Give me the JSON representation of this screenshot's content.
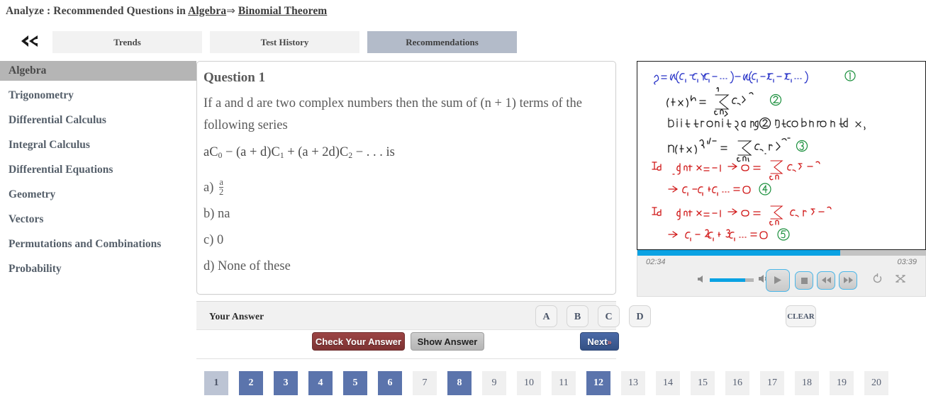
{
  "header": {
    "prefix": "Analyze : Recommended Questions in ",
    "subject_link": "Algebra",
    "arrow": "⇒",
    "topic_link": "Binomial Theorem"
  },
  "nav": {
    "back_icon": "«",
    "tabs": [
      {
        "label": "Trends",
        "active": false
      },
      {
        "label": "Test History",
        "active": false
      },
      {
        "label": "Recommendations",
        "active": true
      }
    ]
  },
  "sidebar": {
    "items": [
      {
        "label": "Algebra",
        "active": true
      },
      {
        "label": "Trigonometry",
        "active": false
      },
      {
        "label": "Differential Calculus",
        "active": false
      },
      {
        "label": "Integral Calculus",
        "active": false
      },
      {
        "label": "Differential Equations",
        "active": false
      },
      {
        "label": "Geometry",
        "active": false
      },
      {
        "label": "Vectors",
        "active": false
      },
      {
        "label": "Permutations and Combinations",
        "active": false
      },
      {
        "label": "Probability",
        "active": false
      }
    ]
  },
  "question": {
    "title": "Question 1",
    "stem": "If a and d are two complex numbers then the sum of (n + 1) terms of the following series",
    "formula_text": "aC0 − (a + d)C1 + (a + 2d)C2 − . . .  is",
    "formula_parts": {
      "p1": "aC",
      "s1": "0",
      "p2": " − (a + d)C",
      "s2": "1",
      "p3": " + (a + 2d)C",
      "s3": "2",
      "p4": " − . . .  is"
    },
    "options": [
      {
        "key": "a)",
        "text": "",
        "fraction": {
          "numerator": "a",
          "denominator": "2"
        }
      },
      {
        "key": "b)",
        "text": "na",
        "fraction": null
      },
      {
        "key": "c)",
        "text": "0",
        "fraction": null
      },
      {
        "key": "d)",
        "text": "None of these",
        "fraction": null
      }
    ]
  },
  "answer_bar": {
    "label": "Your Answer",
    "choices": [
      "A",
      "B",
      "C",
      "D"
    ],
    "clear_label": "CLEAR"
  },
  "actions": {
    "check_label": "Check Your Answer",
    "show_label": "Show Answer",
    "next_label": "Next",
    "next_chevron": "»"
  },
  "pagination": {
    "pages": [
      {
        "num": "1",
        "state": "current"
      },
      {
        "num": "2",
        "state": "visited"
      },
      {
        "num": "3",
        "state": "visited"
      },
      {
        "num": "4",
        "state": "visited"
      },
      {
        "num": "5",
        "state": "visited"
      },
      {
        "num": "6",
        "state": "visited"
      },
      {
        "num": "7",
        "state": "default"
      },
      {
        "num": "8",
        "state": "visited"
      },
      {
        "num": "9",
        "state": "default"
      },
      {
        "num": "10",
        "state": "default"
      },
      {
        "num": "11",
        "state": "default"
      },
      {
        "num": "12",
        "state": "visited"
      },
      {
        "num": "13",
        "state": "default"
      },
      {
        "num": "14",
        "state": "default"
      },
      {
        "num": "15",
        "state": "default"
      },
      {
        "num": "16",
        "state": "default"
      },
      {
        "num": "17",
        "state": "default"
      },
      {
        "num": "18",
        "state": "default"
      },
      {
        "num": "19",
        "state": "default"
      },
      {
        "num": "20",
        "state": "default"
      }
    ]
  },
  "whiteboard": {
    "lines": [
      {
        "text": "S = a(C₀ − C₁ + C₂ −...) − d(C₁ − 2C₂ + 3C₃ −...)",
        "color": "#2a35c8",
        "tag": "①",
        "tag_color": "#1a8f3c"
      },
      {
        "text": "(1+ x)ⁿ =  Σ  Cᵣ xʳ",
        "color": "#1a1a1a",
        "tag": "②",
        "tag_color": "#1a8f3c"
      },
      {
        "text": "Differentiating ② with respect to x,",
        "color": "#1a1a1a",
        "tag": "",
        "tag_color": ""
      },
      {
        "text": "n(1+x)ⁿ⁻¹ =  Σ  Cᵣ . r xʳ⁻¹",
        "color": "#1a1a1a",
        "tag": "③",
        "tag_color": "#1a8f3c"
      },
      {
        "text": "In ②, put x = −1  ⇒  0 = Σ Cᵣ (−)ʳ",
        "color": "#d01818",
        "tag": "",
        "tag_color": ""
      },
      {
        "text": "⇒  C₀ − C₁ + C₂ −... = 0",
        "color": "#d01818",
        "tag": "④",
        "tag_color": "#1a8f3c"
      },
      {
        "text": "In ③, put x = −1 ⇒ 0 = Σ Cᵣ· r (−)ʳ⁻¹",
        "color": "#d01818",
        "tag": "",
        "tag_color": ""
      },
      {
        "text": "⇒  C₁ − 2C₂ + 3C₃ −... = 0",
        "color": "#d01818",
        "tag": "⑤",
        "tag_color": "#1a8f3c"
      }
    ]
  },
  "player": {
    "current_time": "02:34",
    "total_time": "03:39",
    "progress_percent": 70,
    "volume_percent": 80,
    "controls": [
      {
        "name": "volume-down-icon",
        "glyph": "◀"
      },
      {
        "name": "volume-up-icon",
        "glyph": "🔊"
      },
      {
        "name": "play-button",
        "glyph": "▶"
      },
      {
        "name": "stop-button",
        "glyph": "■"
      },
      {
        "name": "rewind-button",
        "glyph": "◀◀"
      },
      {
        "name": "fast-forward-button",
        "glyph": "▶▶"
      },
      {
        "name": "repeat-button",
        "glyph": "↻"
      },
      {
        "name": "shuffle-button",
        "glyph": "⤬"
      }
    ]
  },
  "colors": {
    "accent_blue": "#5b74ac",
    "current_page": "#bcc4d4",
    "check_red": "#8c3b3b",
    "next_blue": "#3c5a96",
    "tab_active": "#b3bbc9",
    "sidebar_active": "#b5b5b5",
    "progress_blue": "#0aa2e3"
  }
}
